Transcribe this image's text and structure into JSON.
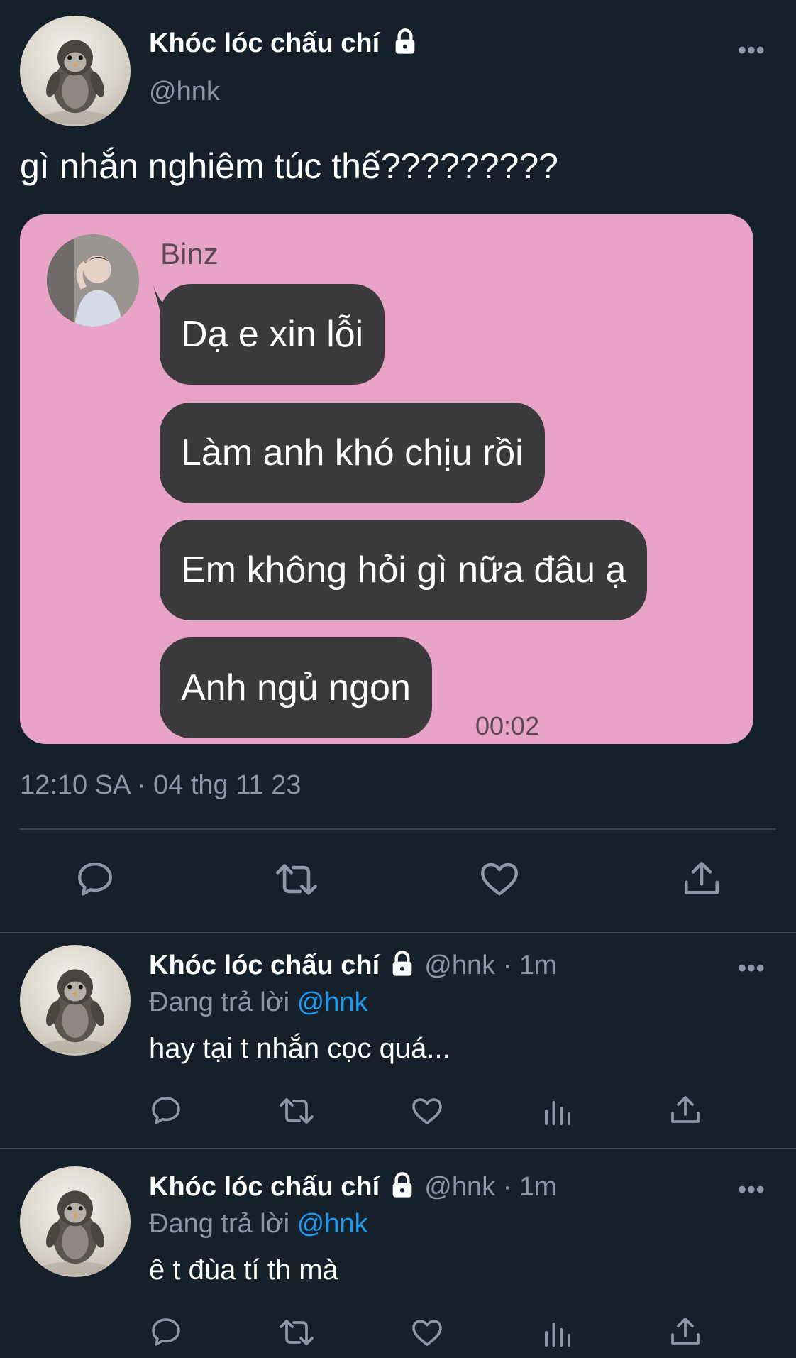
{
  "tweet": {
    "display_name": "Khóc lóc chấu chí",
    "handle": "@hnk",
    "text": "gì nhắn nghiêm túc thế?????????",
    "timestamp": "12:10 SA · 04 thg 11 23",
    "more_label": "•••"
  },
  "embedded_chat": {
    "sender_name": "Binz",
    "messages": [
      "Dạ e xin lỗi",
      "Làm anh khó chịu rồi",
      "Em không hỏi gì nữa đâu ạ",
      "Anh ngủ ngon"
    ],
    "time": "00:02",
    "background_color": "#e8a4c6"
  },
  "actions": {
    "reply_icon": "reply-icon",
    "retweet_icon": "retweet-icon",
    "like_icon": "heart-icon",
    "share_icon": "share-icon",
    "views_icon": "views-icon"
  },
  "replies": [
    {
      "display_name": "Khóc lóc chấu chí",
      "meta": "@hnk · 1m",
      "replying_prefix": "Đang trả lời",
      "replying_to": "@hnk",
      "text": "hay tại t nhắn cọc quá..."
    },
    {
      "display_name": "Khóc lóc chấu chí",
      "meta": "@hnk · 1m",
      "replying_prefix": "Đang trả lời",
      "replying_to": "@hnk",
      "text": "ê t đùa tí th mà"
    }
  ],
  "colors": {
    "background": "#15202b",
    "muted": "#8b98a5",
    "link": "#1d9bf0",
    "bubble": "#3a3a3c"
  }
}
